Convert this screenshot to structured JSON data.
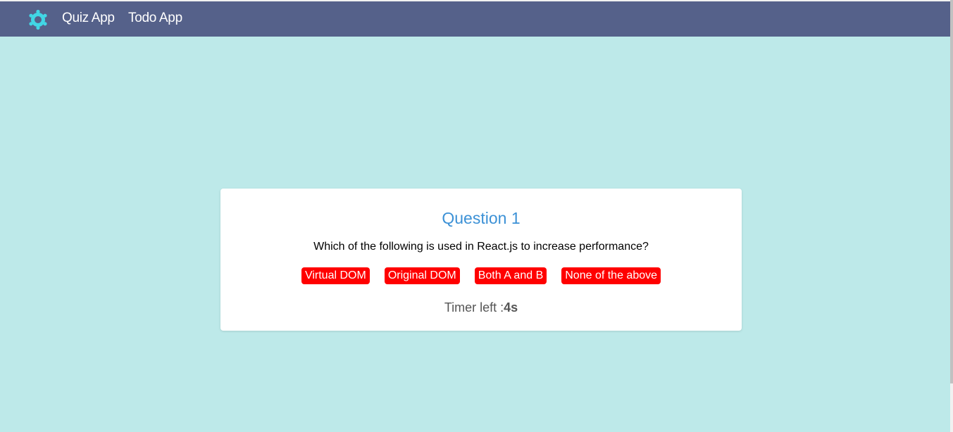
{
  "navbar": {
    "links": [
      "Quiz App",
      "Todo App"
    ],
    "logo_icon": "react-logo-icon",
    "bg_color": "#55618a"
  },
  "quiz": {
    "title": "Question 1",
    "question": "Which of the following is used in React.js to increase performance?",
    "options": [
      "Virtual DOM",
      "Original DOM",
      "Both A and B",
      "None of the above"
    ],
    "timer_label": "Timer left :",
    "timer_value": "4s",
    "title_color": "#3c91d6",
    "option_color": "#ff0000"
  },
  "page": {
    "bg_color": "#bde9e9"
  }
}
